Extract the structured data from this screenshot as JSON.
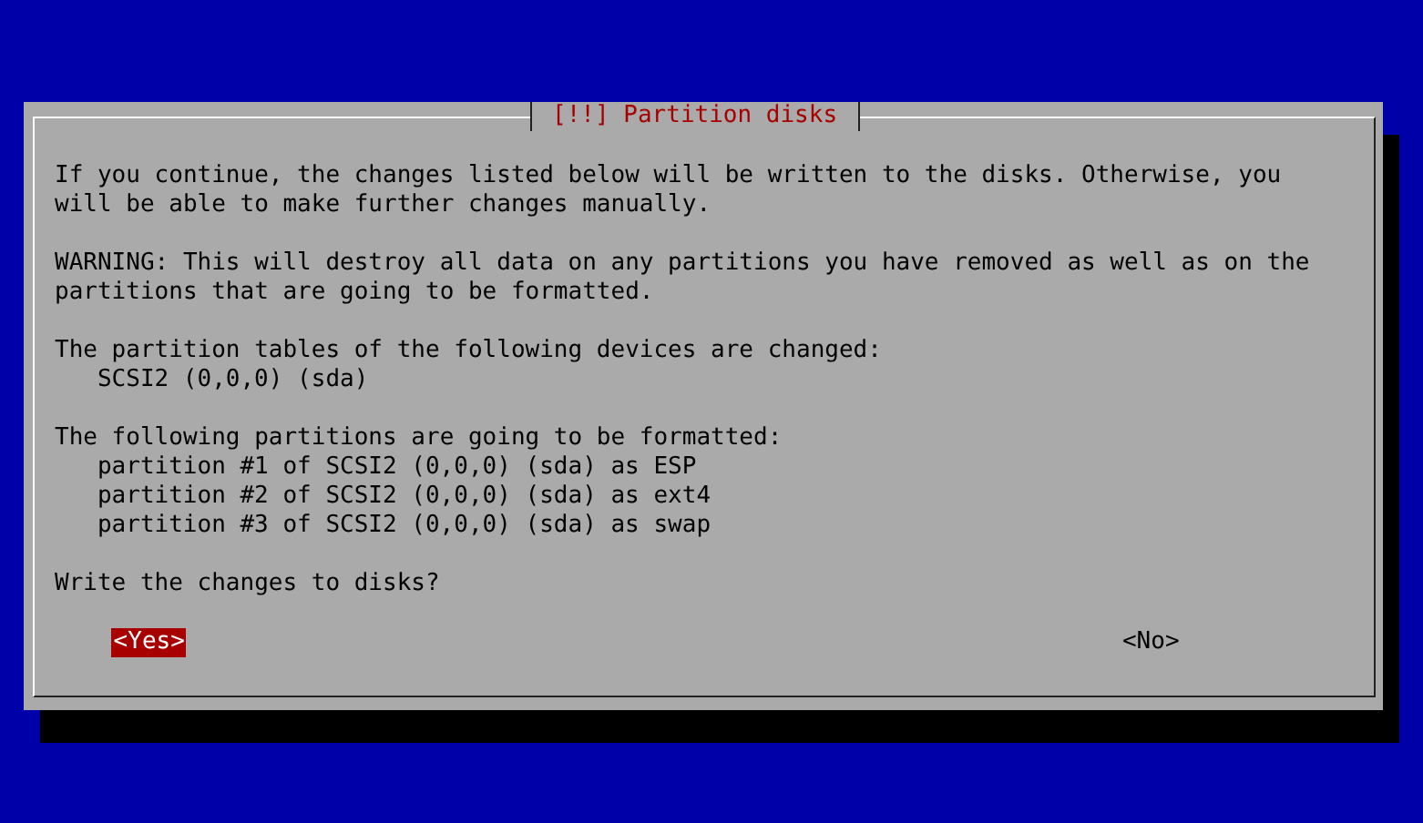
{
  "dialog": {
    "title": "[!!] Partition disks",
    "blocks": [
      {
        "text": "If you continue, the changes listed below will be written to the disks. Otherwise, you will be able to make further changes manually."
      },
      {
        "text": "WARNING: This will destroy all data on any partitions you have removed as well as on the partitions that are going to be formatted."
      },
      {
        "text": "The partition tables of the following devices are changed:",
        "items": [
          "SCSI2 (0,0,0) (sda)"
        ]
      },
      {
        "text": "The following partitions are going to be formatted:",
        "items": [
          "partition #1 of SCSI2 (0,0,0) (sda) as ESP",
          "partition #2 of SCSI2 (0,0,0) (sda) as ext4",
          "partition #3 of SCSI2 (0,0,0) (sda) as swap"
        ]
      },
      {
        "text": "Write the changes to disks?"
      }
    ],
    "buttons": [
      {
        "label": "<Yes>",
        "selected": true
      },
      {
        "label": "<No>",
        "selected": false
      }
    ]
  }
}
